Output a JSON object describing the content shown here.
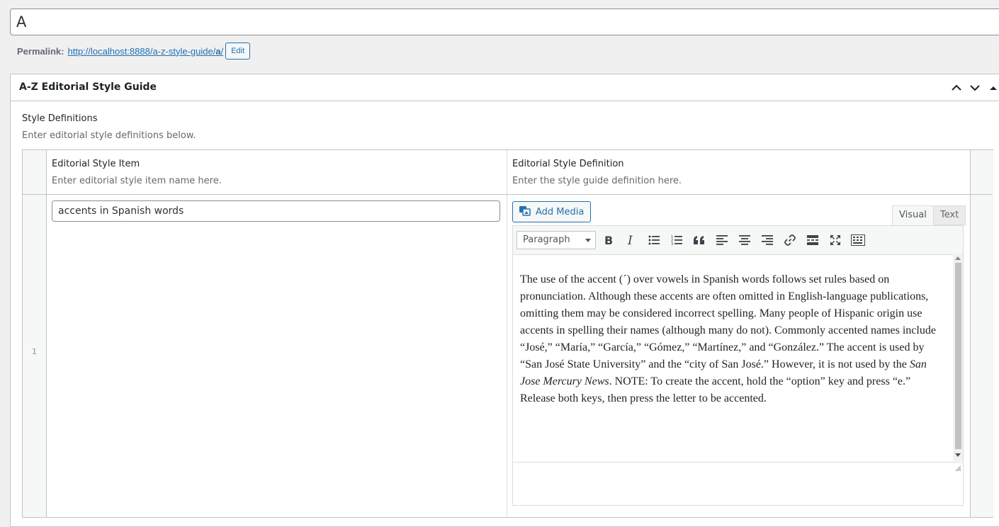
{
  "title_input": {
    "value": "A"
  },
  "permalink": {
    "label": "Permalink:",
    "url_prefix": "http://localhost:8888/a-z-style-guide/",
    "url_slug": "a",
    "url_suffix": "/",
    "edit_label": "Edit"
  },
  "metabox": {
    "title": "A-Z Editorial Style Guide",
    "section_label": "Style Definitions",
    "section_description": "Enter editorial style definitions below.",
    "columns": [
      {
        "title": "Editorial Style Item",
        "hint": "Enter editorial style item name here."
      },
      {
        "title": "Editorial Style Definition",
        "hint": "Enter the style guide definition here."
      }
    ],
    "rows": [
      {
        "number": "1",
        "item_value": "accents in Spanish words",
        "definition_segments": [
          {
            "text": "The use of the accent (´) over vowels in Spanish words follows set rules based on pronunciation. Although these accents are often omitted in English-language publications, omitting them may be considered incorrect spelling. Many people of Hispanic origin use accents in spelling their names (although many do not). Commonly accented names include “José,” “María,” “García,” “Gómez,” “Martínez,” and “González.” The accent is used by “San José State University” and the “city of San José.” However, it is not used by the "
          },
          {
            "text": "San Jose Mercury News",
            "italic": true
          },
          {
            "text": ". NOTE: To create the accent, hold the “option” key and press “e.” Release both keys, then press the letter to be accented."
          }
        ]
      }
    ]
  },
  "editor": {
    "add_media_label": "Add Media",
    "tab_visual": "Visual",
    "tab_text": "Text",
    "format_select_value": "Paragraph",
    "toolbar_icons": [
      "bold-icon",
      "italic-icon",
      "bulleted-list-icon",
      "numbered-list-icon",
      "blockquote-icon",
      "align-left-icon",
      "align-center-icon",
      "align-right-icon",
      "link-icon",
      "read-more-icon",
      "fullscreen-icon",
      "toolbar-toggle-icon"
    ]
  }
}
